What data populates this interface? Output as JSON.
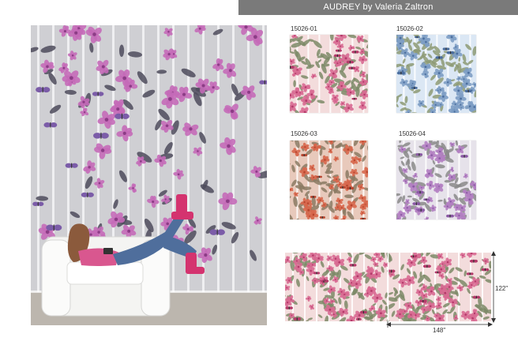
{
  "header": {
    "title": "AUDREY by Valeria Zaltron"
  },
  "swatches": [
    {
      "code": "15026-01",
      "color_name": "pink",
      "bg": "#f3dcdc",
      "flower": "#d86a92",
      "accent": "#b43a6a",
      "leaf": "#7d8a67"
    },
    {
      "code": "15026-02",
      "color_name": "blue",
      "bg": "#dbe7f4",
      "flower": "#7d9dc4",
      "accent": "#4b6e9e",
      "leaf": "#8d9a74"
    },
    {
      "code": "15026-03",
      "color_name": "terracotta",
      "bg": "#e8c9bb",
      "flower": "#d7674d",
      "accent": "#b8452e",
      "leaf": "#8b7a63"
    },
    {
      "code": "15026-04",
      "color_name": "lilac",
      "bg": "#e6e2ea",
      "flower": "#b37fc2",
      "accent": "#8b5aa5",
      "leaf": "#8a8a8a"
    }
  ],
  "panel": {
    "width_label": "148\"",
    "height_label": "122\""
  },
  "room": {
    "wall_bg": "#cfcfd3",
    "flower_color": "#c46ab8",
    "butterfly_color": "#7b5ca8",
    "floor_color": "#bcb6ae",
    "chair_color": "#f4f4f2",
    "boots_color": "#d4336f",
    "jeans_color": "#4f6e9c",
    "sweater_color": "#d9578f"
  }
}
